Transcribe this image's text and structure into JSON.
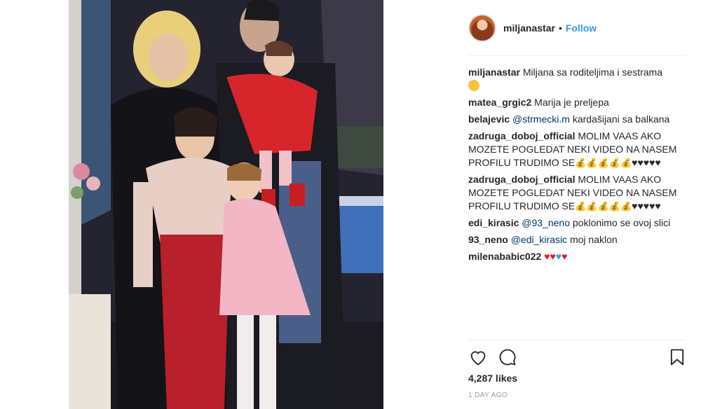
{
  "post": {
    "username": "miljanastar",
    "separator": "•",
    "follow_label": "Follow"
  },
  "comments": [
    {
      "user": "miljanastar",
      "text": "Miljana sa roditeljima i sestrama"
    },
    {
      "user": "matea_grgic2",
      "text": "Marija je preljepa"
    },
    {
      "user": "belajevic",
      "mention": "@strmecki.m",
      "text": "kardašijani sa balkana"
    },
    {
      "user": "zadruga_doboj_official",
      "text": "MOLIM VAAS AKO MOZETE POGLEDAT NEKI VIDEO NA NASEM PROFILU TRUDIMO SE",
      "hearts": "♥♥♥♥♥"
    },
    {
      "user": "zadruga_doboj_official",
      "text": "MOLIM VAAS AKO MOZETE POGLEDAT NEKI VIDEO NA NASEM PROFILU TRUDIMO SE",
      "hearts": "♥♥♥♥♥"
    },
    {
      "user": "edi_kirasic",
      "mention": "@93_neno",
      "text": "poklonimo se ovoj slici"
    },
    {
      "user": "93_neno",
      "mention": "@edi_kirasic",
      "text": "moj naklon"
    },
    {
      "user": "milenababic022"
    }
  ],
  "emoji": {
    "money_bag": "💰",
    "heart": "♥"
  },
  "footer": {
    "likes": "4,287 likes",
    "timestamp": "1 DAY AGO"
  },
  "icons": [
    "heart-icon",
    "comment-icon",
    "bookmark-icon"
  ],
  "colors": {
    "accent": "#3897f0",
    "red_heart": "#e0182d",
    "blue_heart": "#1fa8e0"
  }
}
